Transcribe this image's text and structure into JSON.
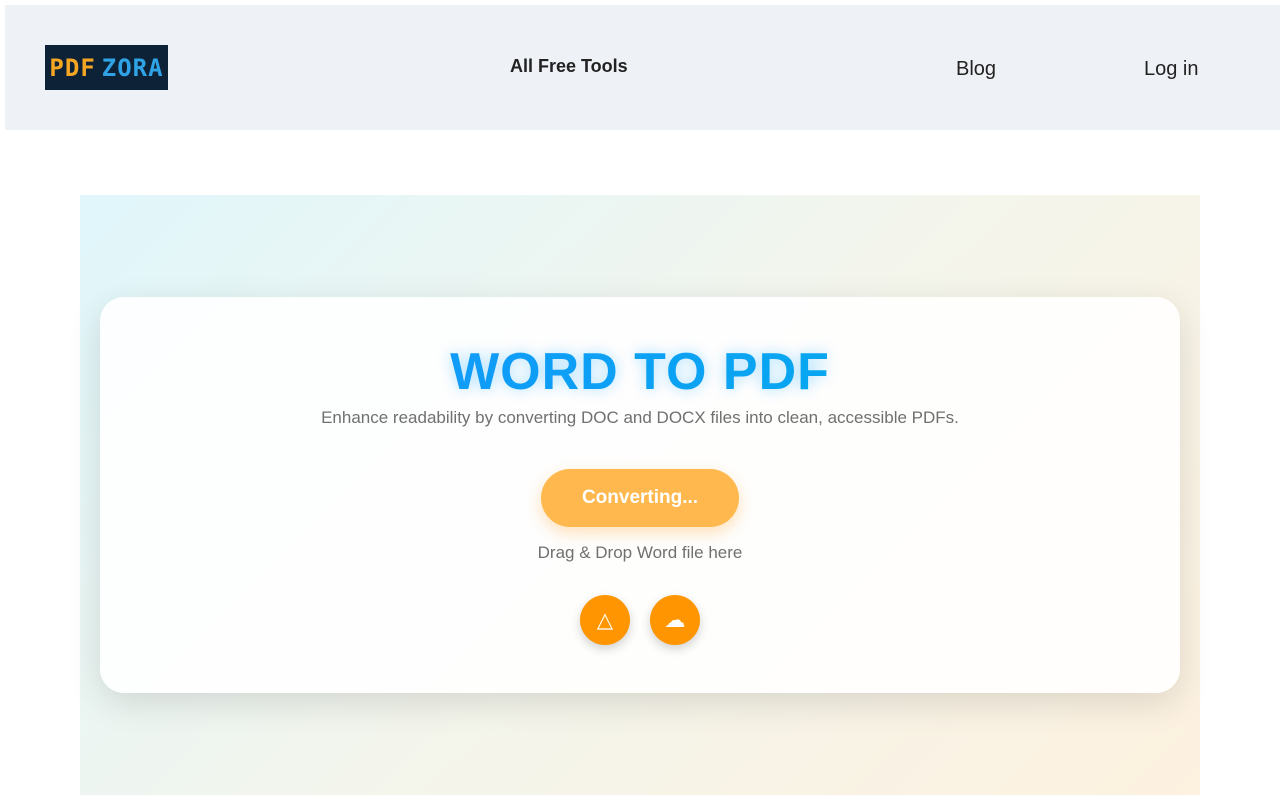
{
  "header": {
    "logo": {
      "part1": "PDF",
      "part2": "ZORA",
      "background": "#0d2236",
      "color1": "#f5a623",
      "color2": "#2fa3e6"
    },
    "nav": {
      "all_free_tools": "All Free Tools",
      "blog": "Blog",
      "login": "Log in"
    }
  },
  "hero": {
    "title": "WORD TO PDF",
    "subtitle": "Enhance readability by converting DOC and DOCX files into clean, accessible PDFs.",
    "convert_button": "Converting...",
    "drop_text": "Drag & Drop Word file here",
    "sources": [
      {
        "icon": "google-drive-icon",
        "glyph": "△"
      },
      {
        "icon": "cloud-icon",
        "glyph": "☁"
      }
    ],
    "colors": {
      "title": "#0a9cff",
      "button": "#ffb84d",
      "source_buttons": "#ff9500"
    }
  }
}
